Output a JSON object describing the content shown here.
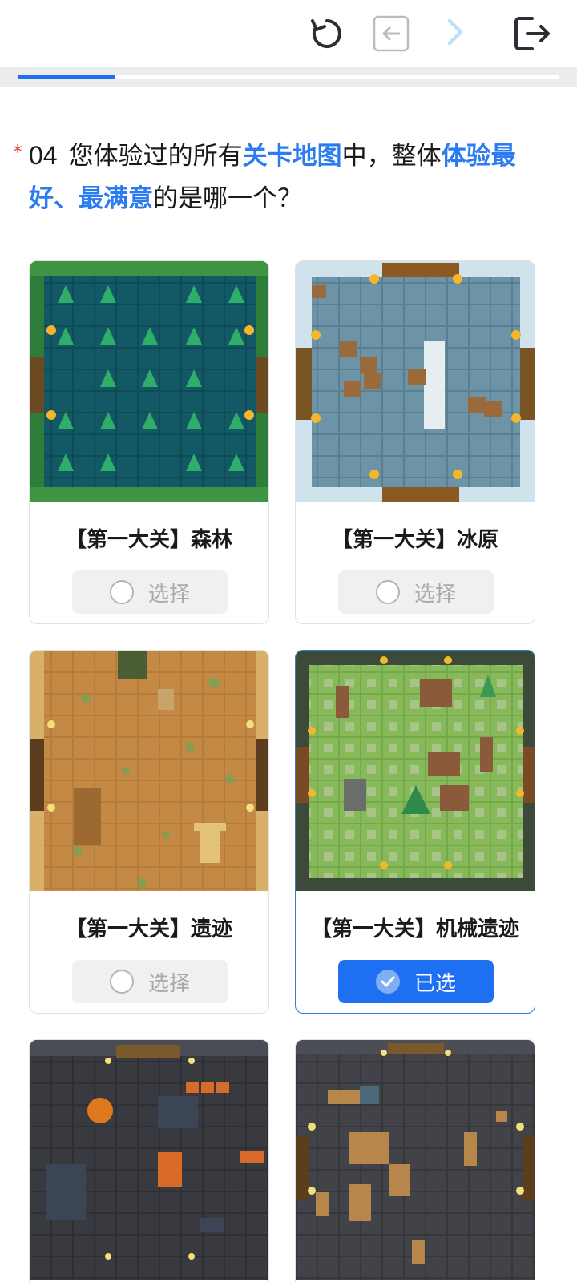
{
  "toolbar": {
    "icons": [
      "refresh-icon",
      "back-icon",
      "forward-icon",
      "exit-icon"
    ]
  },
  "progress": {
    "fraction": 0.18
  },
  "question": {
    "required_mark": "*",
    "number": "04",
    "text_parts": [
      "您体验过的所有",
      "关卡地图",
      "中，整体",
      "体验最好、最满意",
      "的是哪一个？"
    ]
  },
  "options": [
    {
      "label": "【第一大关】森林",
      "button_label": "选择",
      "selected": false
    },
    {
      "label": "【第一大关】冰原",
      "button_label": "选择",
      "selected": false
    },
    {
      "label": "【第一大关】遗迹",
      "button_label": "选择",
      "selected": false
    },
    {
      "label": "【第一大关】机械遗迹",
      "button_label": "已选",
      "selected": true
    }
  ],
  "colors": {
    "accent": "#1f6ff2",
    "highlight_text": "#2b7cf0",
    "required": "#e8453c"
  }
}
